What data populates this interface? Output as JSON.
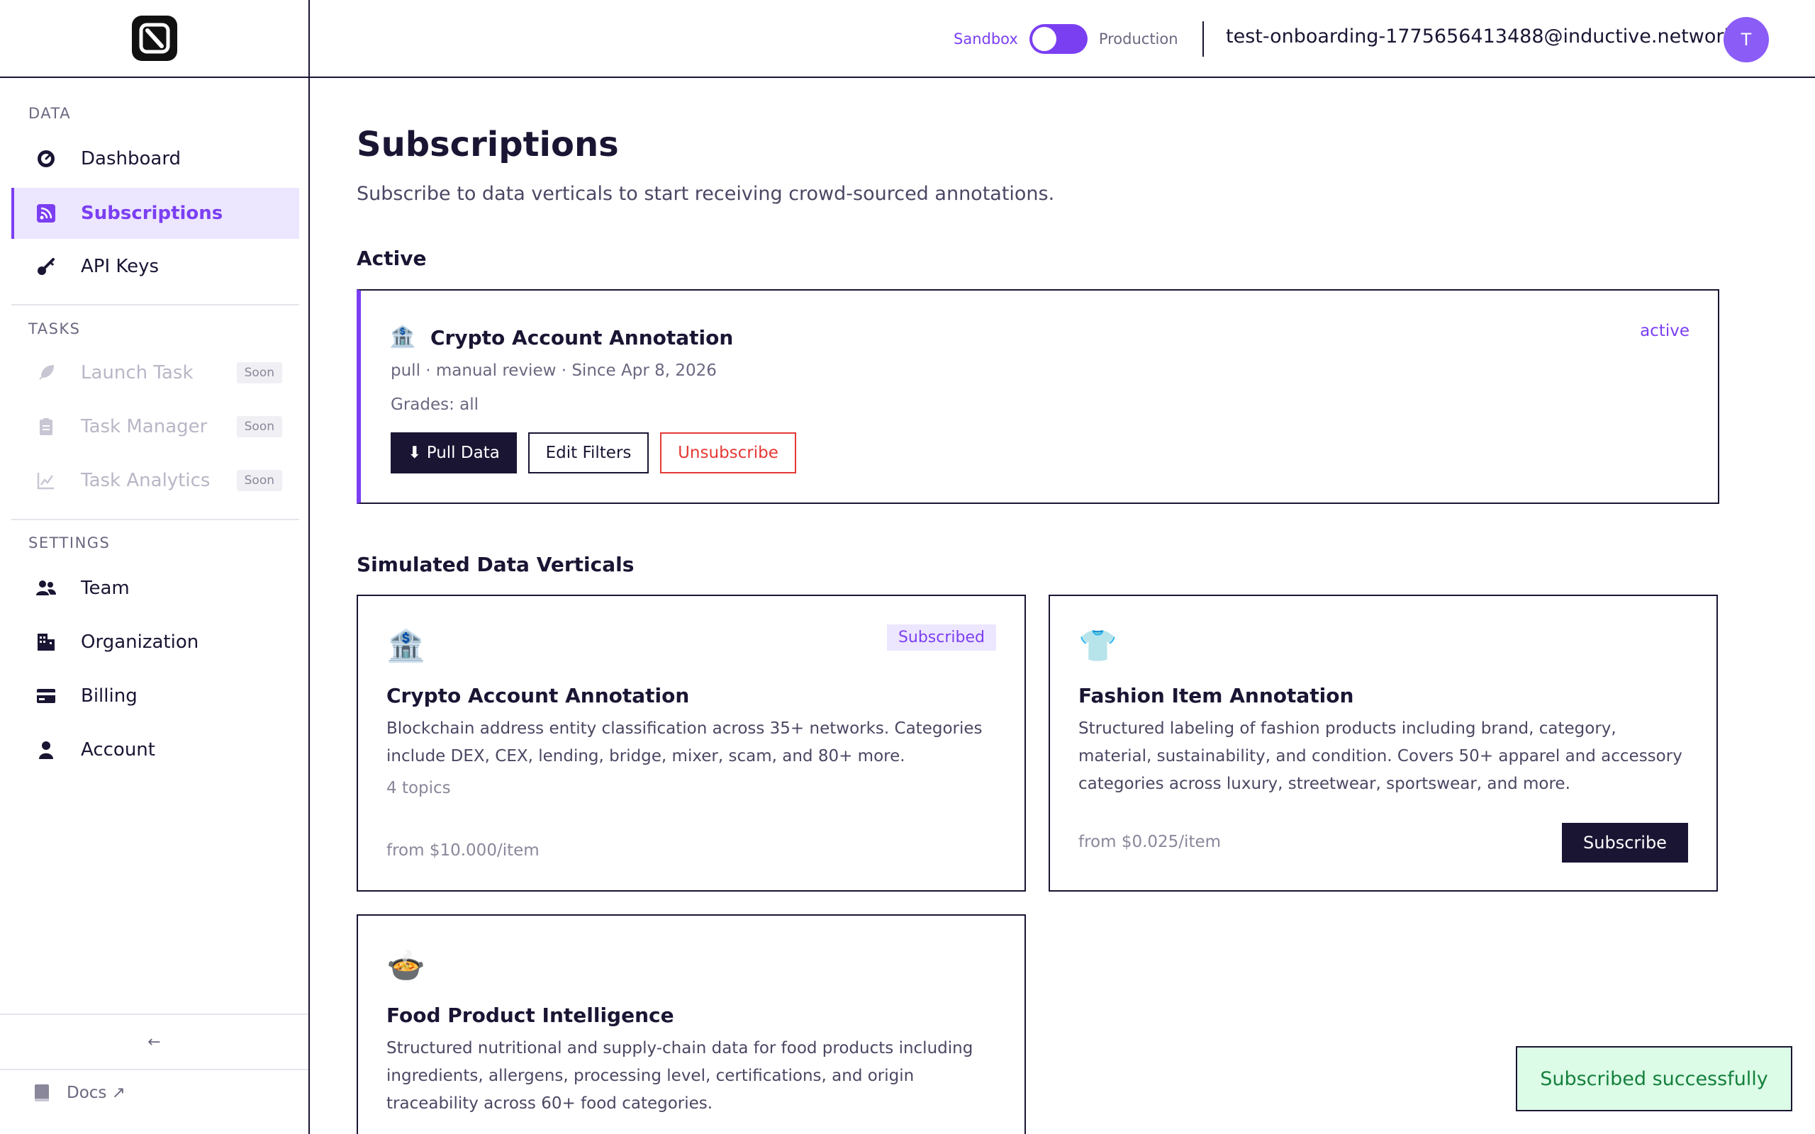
{
  "sidebar": {
    "sections": {
      "data": "DATA",
      "tasks": "TASKS",
      "settings": "SETTINGS"
    },
    "items": {
      "dashboard": "Dashboard",
      "subscriptions": "Subscriptions",
      "api_keys": "API Keys",
      "launch_task": "Launch Task",
      "task_manager": "Task Manager",
      "task_analytics": "Task Analytics",
      "team": "Team",
      "organization": "Organization",
      "billing": "Billing",
      "account": "Account"
    },
    "soon_label": "Soon",
    "collapse_icon": "←",
    "docs_label": "Docs ↗"
  },
  "topbar": {
    "sandbox_label": "Sandbox",
    "production_label": "Production",
    "email": "test-onboarding-1775656413488@inductive.network",
    "avatar_initial": "T"
  },
  "main": {
    "title": "Subscriptions",
    "subtitle": "Subscribe to data verticals to start receiving crowd-sourced annotations.",
    "active_heading": "Active",
    "active_subscription": {
      "emoji": "🏦",
      "name": "Crypto Account Annotation",
      "status": "active",
      "meta": "pull · manual review · Since Apr 8, 2026",
      "grades": "Grades: all",
      "pull_label": "⬇ Pull Data",
      "edit_label": "Edit Filters",
      "unsubscribe_label": "Unsubscribe"
    },
    "verticals_heading": "Simulated Data Verticals",
    "verticals": [
      {
        "emoji": "🏦",
        "badge": "Subscribed",
        "title": "Crypto Account Annotation",
        "description": "Blockchain address entity classification across 35+ networks. Categories include DEX, CEX, lending, bridge, mixer, scam, and 80+ more.",
        "topics": "4 topics",
        "price": "from $10.000/item"
      },
      {
        "emoji": "👕",
        "title": "Fashion Item Annotation",
        "description": "Structured labeling of fashion products including brand, category, material, sustainability, and condition. Covers 50+ apparel and accessory categories across luxury, streetwear, sportswear, and more.",
        "price": "from $0.025/item",
        "button": "Subscribe"
      },
      {
        "emoji": "🍲",
        "title": "Food Product Intelligence",
        "description": "Structured nutritional and supply-chain data for food products including ingredients, allergens, processing level, certifications, and origin traceability across 60+ food categories."
      }
    ]
  },
  "toast": "Subscribed successfully",
  "colors": {
    "accent": "#7b3ff2",
    "dark": "#1a1533",
    "danger": "#e53935",
    "success_bg": "#dcfce7",
    "success_text": "#15803d"
  }
}
